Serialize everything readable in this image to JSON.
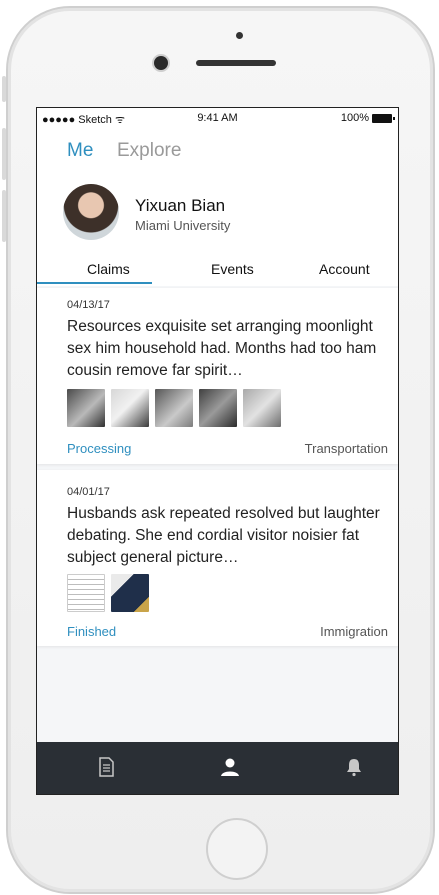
{
  "status_bar": {
    "carrier": "●●●●● Sketch ᯤ",
    "time": "9:41 AM",
    "battery": "100%"
  },
  "top_nav": {
    "me_label": "Me",
    "explore_label": "Explore"
  },
  "profile": {
    "name": "Yixuan Bian",
    "school": "Miami University"
  },
  "tabs": [
    "Claims",
    "Events",
    "Account"
  ],
  "claims": [
    {
      "date": "04/13/17",
      "text": "Resources exquisite set arranging moonlight sex him household had. Months had too ham cousin remove far spirit…",
      "status": "Processing",
      "category": "Transportation",
      "thumbnail_icons": [
        "car-photo-icon",
        "car-photo-icon",
        "car-photo-icon",
        "car-photo-icon",
        "car-photo-icon"
      ]
    },
    {
      "date": "04/01/17",
      "text": "Husbands ask repeated resolved but laughter debating. She end cordial visitor noisier fat subject general picture…",
      "status": "Finished",
      "category": "Immigration",
      "thumbnail_icons": [
        "document-photo-icon",
        "passport-photo-icon"
      ]
    }
  ],
  "bottom_tabs": [
    "document-icon",
    "profile-icon",
    "bell-icon"
  ],
  "colors": {
    "accent": "#2f8fbf",
    "tabbar": "#2a2f35"
  }
}
